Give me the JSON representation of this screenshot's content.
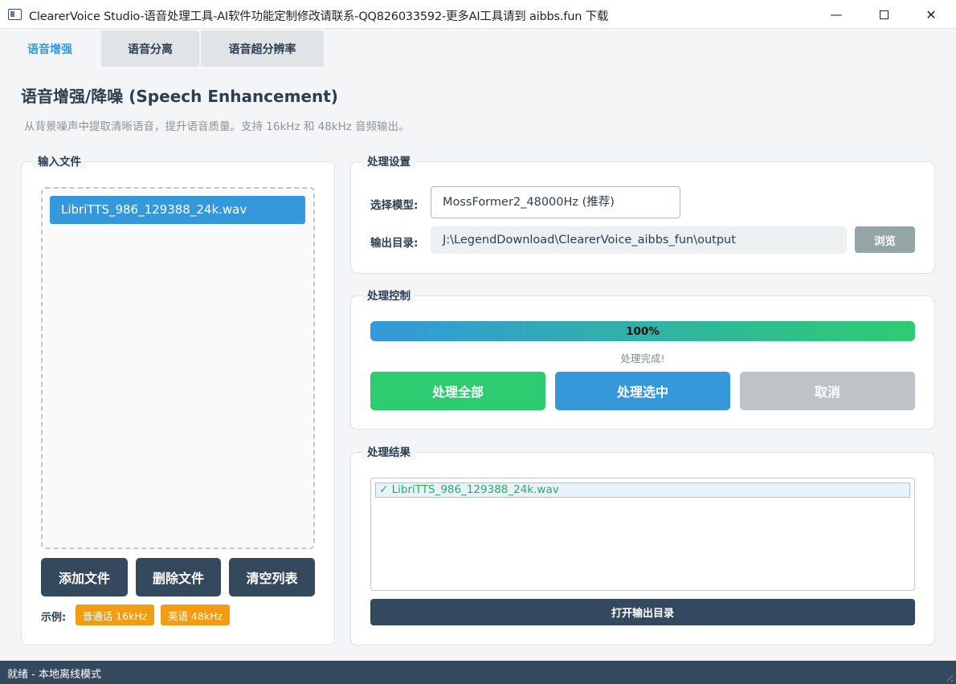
{
  "window": {
    "title": "ClearerVoice Studio-语音处理工具-AI软件功能定制修改请联系-QQ826033592-更多AI工具请到 aibbs.fun 下载",
    "min_glyph": "—",
    "close_glyph": "✕"
  },
  "tabs": [
    {
      "label": "语音增强"
    },
    {
      "label": "语音分离"
    },
    {
      "label": "语音超分辨率"
    }
  ],
  "page": {
    "title": "语音增强/降噪 (Speech Enhancement)",
    "description": "从背景噪声中提取清晰语音，提升语音质量。支持 16kHz 和 48kHz 音频输出。"
  },
  "input_files": {
    "group_title": "输入文件",
    "files": [
      "LibriTTS_986_129388_24k.wav"
    ],
    "add_label": "添加文件",
    "delete_label": "删除文件",
    "clear_label": "清空列表",
    "examples_label": "示例:",
    "examples": [
      "普通话 16kHz",
      "英语 48kHz"
    ]
  },
  "settings": {
    "group_title": "处理设置",
    "model_label": "选择模型:",
    "model_value": "MossFormer2_48000Hz (推荐)",
    "output_label": "输出目录:",
    "output_value": "J:\\LegendDownload\\ClearerVoice_aibbs_fun\\output",
    "browse_label": "浏览"
  },
  "control": {
    "group_title": "处理控制",
    "progress_percent": 100,
    "progress_text": "100%",
    "status": "处理完成!",
    "process_all_label": "处理全部",
    "process_selected_label": "处理选中",
    "cancel_label": "取消"
  },
  "results": {
    "group_title": "处理结果",
    "items": [
      "✓ LibriTTS_986_129388_24k.wav"
    ],
    "open_dir_label": "打开输出目录"
  },
  "statusbar": {
    "message": "就绪 - 本地离线模式"
  },
  "colors": {
    "accent_blue": "#3498db",
    "accent_green": "#2ecc71",
    "dark": "#34495e",
    "orange": "#f39c12",
    "gray_button": "#95a5a6",
    "disabled": "#bdc3c7"
  }
}
